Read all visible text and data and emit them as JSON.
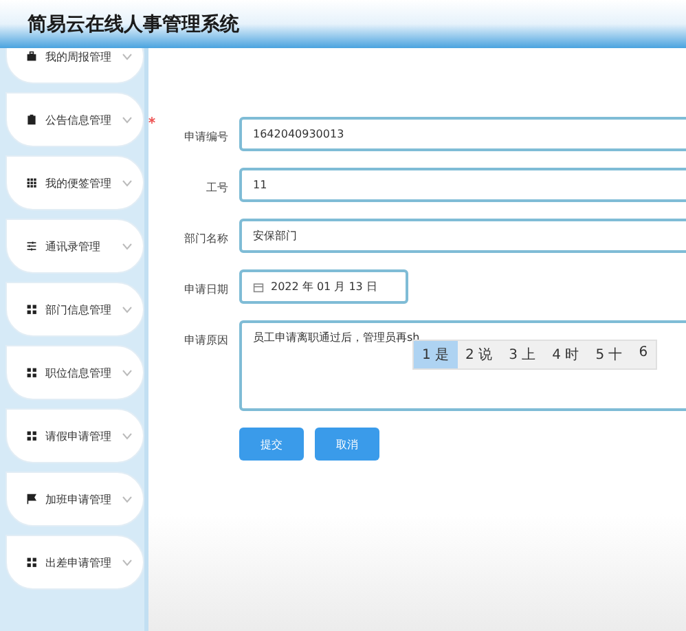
{
  "header": {
    "title": "简易云在线人事管理系统"
  },
  "sidebar": {
    "items": [
      {
        "label": "我的周报管理"
      },
      {
        "label": "公告信息管理"
      },
      {
        "label": "我的便签管理"
      },
      {
        "label": "通讯录管理"
      },
      {
        "label": "部门信息管理"
      },
      {
        "label": "职位信息管理"
      },
      {
        "label": "请假申请管理"
      },
      {
        "label": "加班申请管理"
      },
      {
        "label": "出差申请管理"
      }
    ]
  },
  "form": {
    "fields": [
      {
        "label": "申请编号",
        "required": true,
        "kind": "text",
        "value": "1642040930013"
      },
      {
        "label": "工号",
        "required": false,
        "kind": "text",
        "value": "11"
      },
      {
        "label": "部门名称",
        "required": false,
        "kind": "text",
        "value": "安保部门"
      },
      {
        "label": "申请日期",
        "required": false,
        "kind": "date",
        "value": "2022 年 01 月 13 日"
      },
      {
        "label": "申请原因",
        "required": false,
        "kind": "textarea",
        "value": "员工申请离职通过后，管理员再sh"
      }
    ],
    "buttons": [
      "提交",
      "取消"
    ]
  },
  "ime": {
    "candidates": [
      {
        "text": "1 是",
        "selected": true
      },
      {
        "text": "2 说",
        "selected": false
      },
      {
        "text": "3 上",
        "selected": false
      },
      {
        "text": "4 时",
        "selected": false
      },
      {
        "text": "5 十",
        "selected": false
      },
      {
        "text": "6",
        "selected": false
      }
    ]
  }
}
